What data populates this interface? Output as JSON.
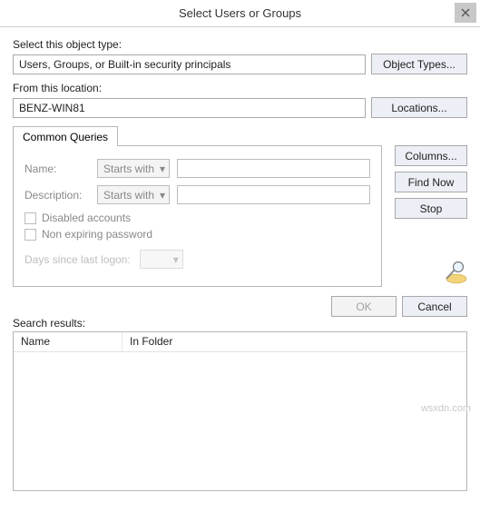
{
  "title": "Select Users or Groups",
  "objectType": {
    "label": "Select this object type:",
    "value": "Users, Groups, or Built-in security principals",
    "button": "Object Types..."
  },
  "location": {
    "label": "From this location:",
    "value": "BENZ-WIN81",
    "button": "Locations..."
  },
  "tab": "Common Queries",
  "queries": {
    "nameLabel": "Name:",
    "nameMode": "Starts with",
    "descLabel": "Description:",
    "descMode": "Starts with",
    "disabled": "Disabled accounts",
    "nonexpire": "Non expiring password",
    "daysLabel": "Days since last logon:"
  },
  "sideButtons": {
    "columns": "Columns...",
    "findNow": "Find Now",
    "stop": "Stop"
  },
  "footer": {
    "ok": "OK",
    "cancel": "Cancel"
  },
  "results": {
    "label": "Search results:",
    "colName": "Name",
    "colFolder": "In Folder"
  },
  "watermark": "wsxdn.com"
}
